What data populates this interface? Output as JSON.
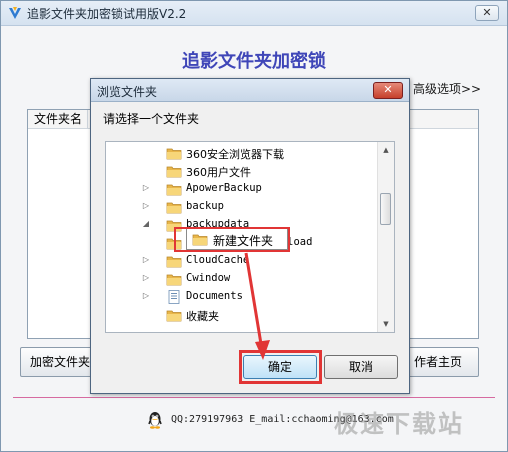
{
  "main_window": {
    "title": "追影文件夹加密锁试用版V2.2",
    "close_glyph": "✕",
    "heading": "追影文件夹加密锁",
    "advanced_link": "高级选项>>",
    "list": {
      "column_header": "文件夹名"
    },
    "encrypt_button": "加密文件夹",
    "author_button": "作者主页",
    "contact": "QQ:279197963 E_mail:cchaoming@163.com"
  },
  "watermark": "极速下载站",
  "dialog": {
    "title": "浏览文件夹",
    "close_glyph": "✕",
    "prompt": "请选择一个文件夹",
    "tree_items": [
      {
        "label": "360安全浏览器下载",
        "expander": ""
      },
      {
        "label": "360用户文件",
        "expander": ""
      },
      {
        "label": "ApowerBackup",
        "expander": "▷"
      },
      {
        "label": "backup",
        "expander": "▷"
      },
      {
        "label": "backupdata",
        "expander": "◢"
      },
      {
        "label": "BaiduNetdiskDownload",
        "expander": ""
      },
      {
        "label": "CloudCache",
        "expander": "▷"
      },
      {
        "label": "Cwindow",
        "expander": "▷"
      },
      {
        "label": "Documents",
        "expander": "▷"
      },
      {
        "label": "收藏夹",
        "expander": ""
      }
    ],
    "new_folder_label": "新建文件夹",
    "ok_button": "确定",
    "cancel_button": "取消"
  },
  "colors": {
    "heading": "#3f46b8",
    "highlight": "#e13535",
    "divider": "#d66aa0"
  }
}
